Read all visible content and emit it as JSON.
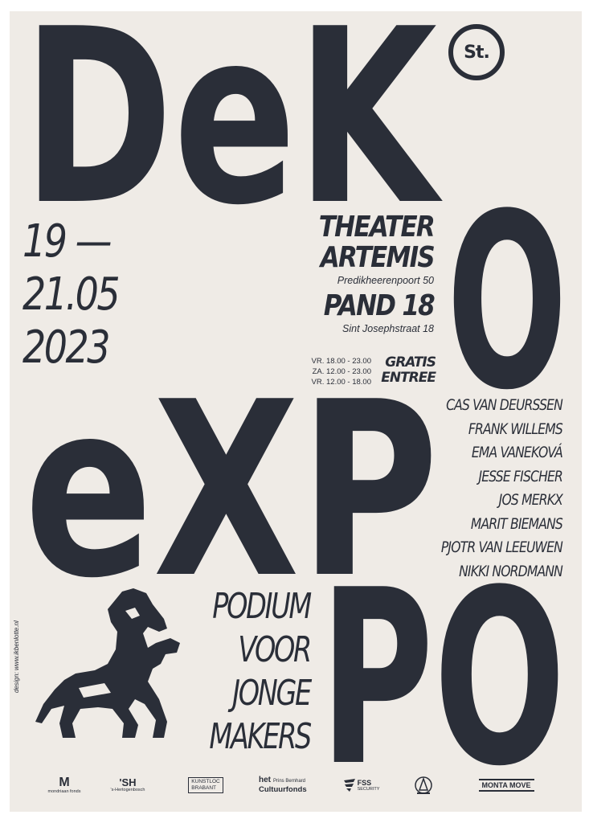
{
  "poster": {
    "title_words": {
      "dek": "DeK",
      "o": "O",
      "exp": "eXP",
      "po": "PO"
    },
    "logo_text": "St.",
    "dates": [
      "19 —",
      "21.05",
      "2023"
    ],
    "venues": [
      {
        "name_lines": [
          "THEATER",
          "ARTEMIS"
        ],
        "address": "Predikheerenpoort 50"
      },
      {
        "name_lines": [
          "PAND 18"
        ],
        "address": "Sint Josephstraat 18"
      }
    ],
    "hours": [
      "VR. 18.00 - 23.00",
      "ZA. 12.00 - 23.00",
      "VR. 12.00 - 18.00"
    ],
    "admission": [
      "GRATIS",
      "ENTREE"
    ],
    "artists": [
      "CAS VAN DEURSSEN",
      "FRANK WILLEMS",
      "EMA VANEKOVÁ",
      "JESSE FISCHER",
      "JOS MERKX",
      "MARIT BIEMANS",
      "PJOTR VAN LEEUWEN",
      "NIKKI NORDMANN"
    ],
    "tagline": [
      "PODIUM",
      "VOOR",
      "JONGE",
      "MAKERS"
    ],
    "design_credit": "design: www.ikbenlotte.nl",
    "sponsors": {
      "mondriaan": {
        "main": "M",
        "sub": "mondriaan fonds"
      },
      "sh": {
        "main": "'SH",
        "sub": "'s-Hertogenbosch"
      },
      "kunstloc": {
        "line1": "KUNSTLOC",
        "line2": "BRABANT"
      },
      "prins": {
        "main": "het",
        "small": "Prins Bernhard",
        "line2": "Cultuurfonds"
      },
      "fss": {
        "main": "FSS",
        "sub": "SECURITY"
      },
      "monta": {
        "main": "MONTA MOVE"
      }
    },
    "colors": {
      "ink": "#2a2e38",
      "paper": "#efebe6"
    },
    "icons": [
      "horse-rearing-icon",
      "st-circle-logo"
    ]
  }
}
